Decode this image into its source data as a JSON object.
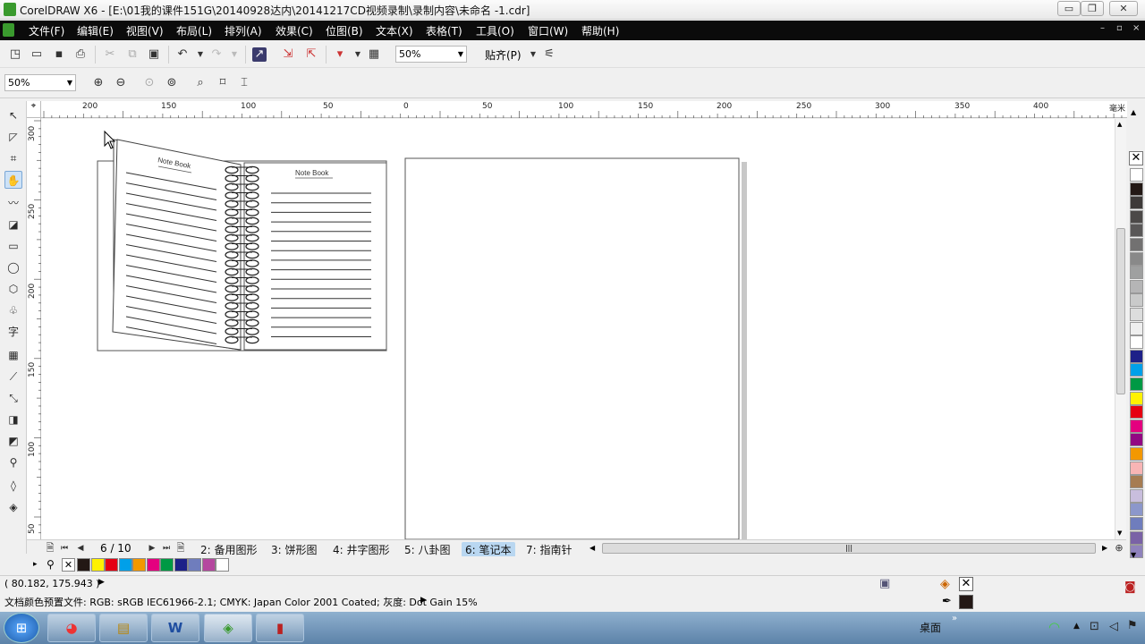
{
  "window": {
    "title": "CorelDRAW X6 - [E:\\01我的课件151G\\20140928达内\\20141217CD视频录制\\录制内容\\未命名 -1.cdr]",
    "btn_min": "▭",
    "btn_restore": "❐",
    "btn_close": "✕"
  },
  "menu": {
    "items": [
      "文件(F)",
      "编辑(E)",
      "视图(V)",
      "布局(L)",
      "排列(A)",
      "效果(C)",
      "位图(B)",
      "文本(X)",
      "表格(T)",
      "工具(O)",
      "窗口(W)",
      "帮助(H)"
    ],
    "controls": [
      "–",
      "▫",
      "×"
    ]
  },
  "toolbar": {
    "zoom_value": "50%",
    "snap_label": "贴齐(P)"
  },
  "propbar": {
    "zoom_value": "50%"
  },
  "rulers": {
    "unit": "毫米",
    "h_labels": [
      "200",
      "150",
      "100",
      "50",
      "0",
      "50",
      "100",
      "150",
      "200",
      "250",
      "300",
      "350",
      "400"
    ],
    "v_labels": [
      "300",
      "250",
      "200",
      "150",
      "100",
      "50"
    ]
  },
  "drawing": {
    "left_page_title": "Note Book",
    "right_page_title": "Note Book"
  },
  "pages": {
    "indicator": "6 / 10",
    "tabs": [
      "2: 备用图形",
      "3: 饼形图",
      "4: 井字图形",
      "5: 八卦图",
      "6: 笔记本",
      "7: 指南针"
    ],
    "active_index": 4
  },
  "status": {
    "coords": "( 80.182, 175.943 )",
    "color_profile": "文档颜色预置文件: RGB: sRGB IEC61966-2.1; CMYK: Japan Color 2001 Coated; 灰度: Dot Gain 15%"
  },
  "palette_colors": [
    "#ffffff",
    "#231815",
    "#3e3a39",
    "#4c4948",
    "#595757",
    "#727171",
    "#898989",
    "#9fa0a0",
    "#b5b5b6",
    "#c9caca",
    "#dcdddd",
    "#efefef",
    "#ffffff",
    "#1d2088",
    "#00a0e9",
    "#009944",
    "#fff100",
    "#e60012",
    "#e4007f",
    "#920783",
    "#f39800",
    "#f8b5b5",
    "#a67c52",
    "#c9bedd",
    "#8c97cb",
    "#6f7dbd",
    "#7a62a6",
    "#8f82bc"
  ],
  "doc_palette": [
    "#231815",
    "#fff100",
    "#e60012",
    "#00a0e9",
    "#f39800",
    "#e4007f",
    "#009944",
    "#1d2088",
    "#6f7dbd",
    "#b5479f",
    "#ffffff"
  ],
  "taskbar": {
    "desktop_label": "桌面",
    "apps": [
      "W"
    ]
  }
}
